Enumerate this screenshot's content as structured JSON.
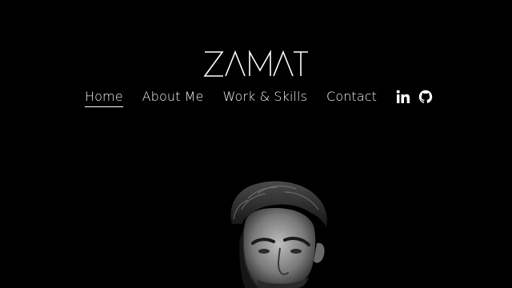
{
  "brand": {
    "logo_text": "ZAMAT"
  },
  "nav": {
    "items": [
      {
        "label": "Home",
        "active": true
      },
      {
        "label": "About Me",
        "active": false
      },
      {
        "label": "Work & Skills",
        "active": false
      },
      {
        "label": "Contact",
        "active": false
      }
    ],
    "social": [
      {
        "icon": "linkedin-icon"
      },
      {
        "icon": "github-icon"
      }
    ]
  },
  "colors": {
    "background": "#000000",
    "text": "#f2f2f2"
  }
}
